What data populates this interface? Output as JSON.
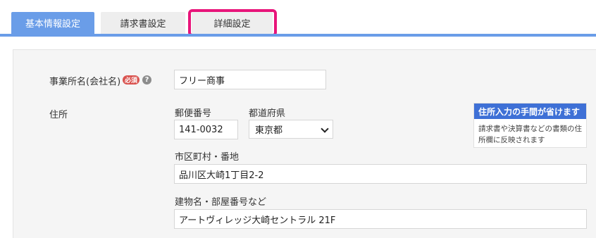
{
  "tabs": [
    {
      "label": "基本情報設定",
      "active": true
    },
    {
      "label": "請求書設定",
      "active": false
    },
    {
      "label": "詳細設定",
      "active": false,
      "highlighted": true
    }
  ],
  "form": {
    "company_name": {
      "label": "事業所名(会社名)",
      "required_badge": "必須",
      "help_icon": "?",
      "value": "フリー商事"
    },
    "address": {
      "label": "住所",
      "postal_code": {
        "label": "郵便番号",
        "value": "141-0032"
      },
      "prefecture": {
        "label": "都道府県",
        "selected": "東京都"
      },
      "city_street": {
        "label": "市区町村・番地",
        "value": "品川区大崎1丁目2-2"
      },
      "building": {
        "label": "建物名・部屋番号など",
        "value": "アートヴィレッジ大崎セントラル 21F"
      }
    },
    "hint": {
      "title": "住所入力の手間が省けます",
      "body": "請求書や決算書などの書類の住所欄に反映されます"
    }
  },
  "colors": {
    "tab_active": "#6a9de8",
    "highlight": "#e8157a",
    "hint_title_bg": "#3e70d6",
    "required_badge": "#d9534f"
  }
}
